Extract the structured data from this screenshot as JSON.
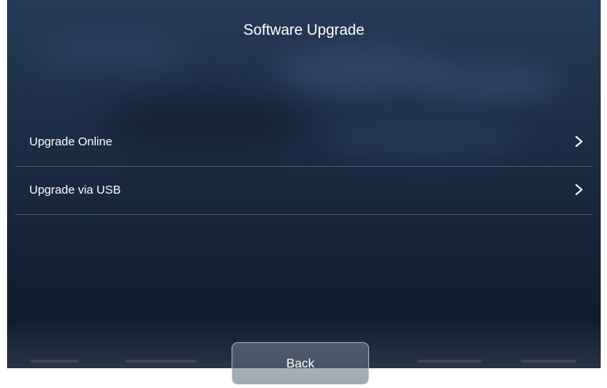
{
  "screen": {
    "title": "Software Upgrade",
    "colors": {
      "background": "#1e3049",
      "text": "#ffffff",
      "divider": "rgba(255,255,255,0.22)"
    }
  },
  "menu": {
    "items": [
      {
        "label": "Upgrade Online",
        "icon": "chevron-right-icon"
      },
      {
        "label": "Upgrade via USB",
        "icon": "chevron-right-icon"
      }
    ]
  },
  "footer": {
    "back_label": "Back"
  }
}
